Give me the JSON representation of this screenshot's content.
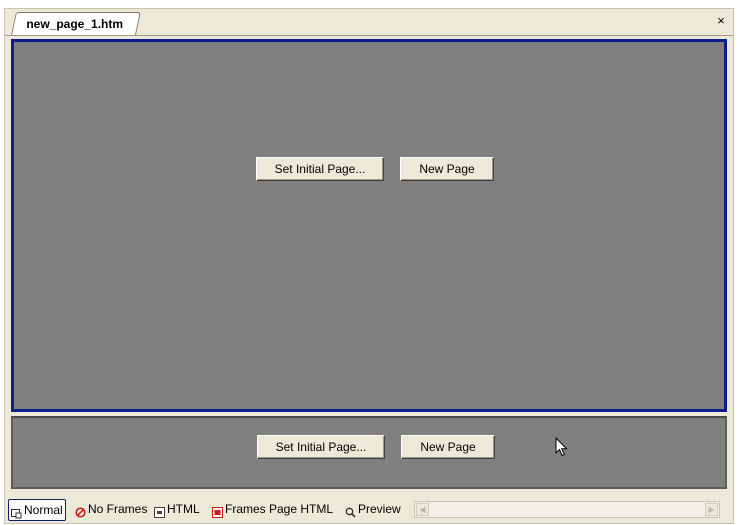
{
  "tab": {
    "title": "new_page_1.htm",
    "close": "×"
  },
  "frames": {
    "top": {
      "set_initial_label": "Set Initial Page...",
      "new_page_label": "New Page"
    },
    "bottom": {
      "set_initial_label": "Set Initial Page...",
      "new_page_label": "New Page"
    }
  },
  "view_tabs": [
    {
      "label": "Normal",
      "icon": "design-view-icon",
      "active": true
    },
    {
      "label": "No Frames",
      "icon": "no-frames-icon"
    },
    {
      "label": "HTML",
      "icon": "html-code-icon"
    },
    {
      "label": "Frames Page HTML",
      "icon": "frames-html-icon"
    },
    {
      "label": "Preview",
      "icon": "magnifier-icon"
    }
  ],
  "colors": {
    "frame_fill": "#808080",
    "selected_frame_border": "#0a1e8c",
    "chrome": "#ece9d8",
    "frames_html_icon": "#d11b1b",
    "no_frames_icon": "#cc1111"
  }
}
